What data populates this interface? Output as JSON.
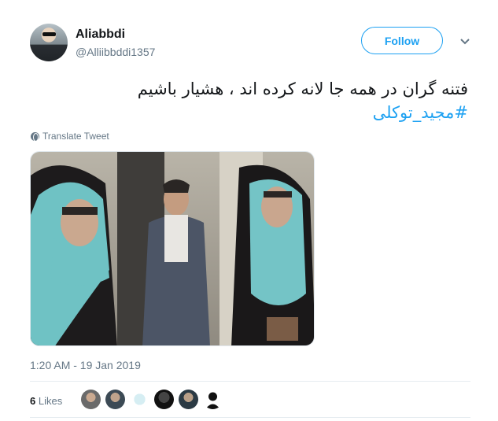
{
  "user": {
    "display_name": "Aliabbdi",
    "handle": "@Alliibbddi1357"
  },
  "follow_label": "Follow",
  "tweet": {
    "text": "فتنه گران در همه جا لانه کرده اند ، هشیار باشیم",
    "hashtag": "#مجید_توکلی"
  },
  "translate_label": "Translate Tweet",
  "timestamp": "1:20 AM - 19 Jan 2019",
  "likes": {
    "count": "6",
    "label": "Likes"
  },
  "colors": {
    "accent": "#1da1f2",
    "secondary_text": "#657786",
    "primary_text": "#14171a"
  }
}
